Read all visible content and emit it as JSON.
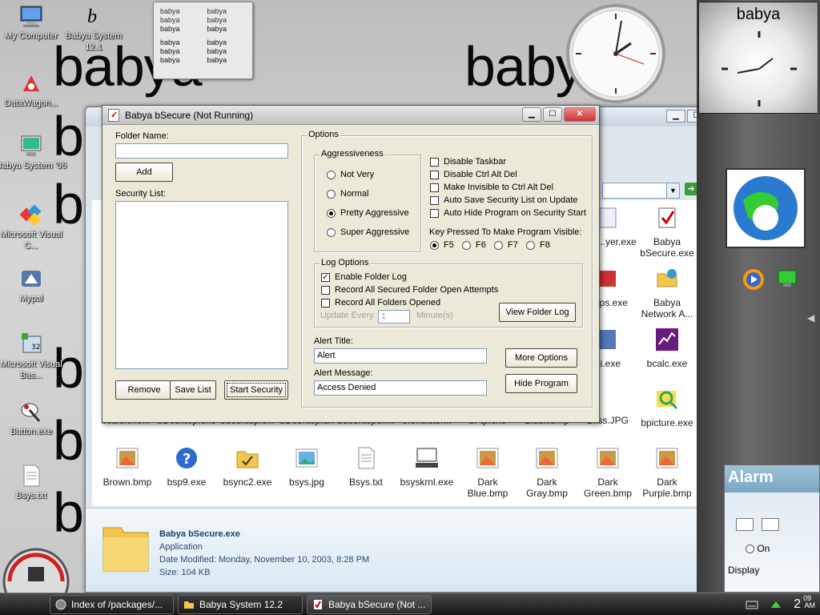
{
  "desktop": {
    "background_word": "babya",
    "icons": [
      {
        "label": "My Computer",
        "icon": "computer-icon"
      },
      {
        "label": "Babya System 12.1",
        "icon": "babya-logo-icon"
      },
      {
        "label": "DataWagon...",
        "icon": "datawagon-icon"
      },
      {
        "label": "Babya System '06",
        "icon": "babya-system-icon"
      },
      {
        "label": "Microsoft Visual C...",
        "icon": "visual-c-icon"
      },
      {
        "label": "Mypal",
        "icon": "mypal-icon"
      },
      {
        "label": "Microsoft Visual Bas...",
        "icon": "visual-basic-icon"
      },
      {
        "label": "Button.exe",
        "icon": "button-exe-icon"
      },
      {
        "label": "Bsys.txt",
        "icon": "text-file-icon"
      }
    ]
  },
  "note_gadget": {
    "rows": [
      [
        "babya",
        "babya"
      ],
      [
        "babya",
        "babya"
      ],
      [
        "babya",
        "babya"
      ],
      [
        "babya",
        "babya"
      ],
      [
        "babya",
        "babya"
      ],
      [
        "babya",
        "babya"
      ]
    ]
  },
  "sidebar": {
    "clock_title": "babya",
    "alarm_title": "Alarm",
    "alarm_on_label": "On",
    "alarm_display_label": "Display"
  },
  "explorer": {
    "go_label": "Go",
    "files": [
      {
        "label": "Babya bSecure.exe",
        "icon": "bsecure-icon"
      },
      {
        "label": "Babya Network A...",
        "icon": "network-icon"
      },
      {
        "label": "bcalc.exe",
        "icon": "bcalc-icon"
      },
      {
        "label": "bpicture.exe",
        "icon": "bpicture-icon"
      },
      {
        "label": "Brown.bmp",
        "icon": "bmp-icon"
      },
      {
        "label": "bsp9.exe",
        "icon": "help-icon"
      },
      {
        "label": "bsync2.exe",
        "icon": "folder-sync-icon"
      },
      {
        "label": "bsys.jpg",
        "icon": "jpg-icon"
      },
      {
        "label": "Bsys.txt",
        "icon": "text-file-icon"
      },
      {
        "label": "bsyskrnl.exe",
        "icon": "kernel-icon"
      },
      {
        "label": "Dark Blue.bmp",
        "icon": "bmp-icon"
      },
      {
        "label": "Dark Gray.bmp",
        "icon": "bmp-icon"
      },
      {
        "label": "Dark Green.bmp",
        "icon": "bmp-icon"
      },
      {
        "label": "Dark Purple.bmp",
        "icon": "bmp-icon"
      }
    ],
    "partial_labels": [
      "bcalc.exe...",
      "bDesktop.exe",
      "bdesktop.c...",
      "bDesktop.url",
      "bdesktopex...",
      "bfontlister...",
      "bFtp.exe",
      "Black.bmp",
      "Bliss.JPG",
      "aya ...yer.exe",
      "Apps.exe",
      "ai.exe"
    ],
    "details": {
      "name": "Babya bSecure.exe",
      "type": "Application",
      "modified": "Date Modified: Monday, November 10, 2003, 8:28 PM",
      "size": "Size: 104 KB"
    }
  },
  "dialog": {
    "title": "Babya bSecure (Not Running)",
    "folder_name_label": "Folder Name:",
    "folder_name_value": "",
    "add_button": "Add",
    "security_list_label": "Security List:",
    "remove_button": "Remove",
    "save_list_button": "Save List",
    "start_security_button": "Start Security",
    "options_legend": "Options",
    "aggressiveness_legend": "Aggressiveness",
    "aggressiveness_options": [
      {
        "label": "Not Very",
        "selected": false
      },
      {
        "label": "Normal",
        "selected": false
      },
      {
        "label": "Pretty Aggressive",
        "selected": true
      },
      {
        "label": "Super Aggressive",
        "selected": false
      }
    ],
    "checkboxes": [
      {
        "label": "Disable Taskbar",
        "checked": false
      },
      {
        "label": "Disable Ctrl Alt Del",
        "checked": false
      },
      {
        "label": "Make Invisible to Ctrl Alt Del",
        "checked": false
      },
      {
        "label": "Auto Save Security List on Update",
        "checked": false
      },
      {
        "label": "Auto Hide Program on Security Start",
        "checked": false
      }
    ],
    "key_label": "Key Pressed To Make Program Visible:",
    "keys": [
      {
        "label": "F5",
        "selected": true
      },
      {
        "label": "F6",
        "selected": false
      },
      {
        "label": "F7",
        "selected": false
      },
      {
        "label": "F8",
        "selected": false
      }
    ],
    "log_legend": "Log Options",
    "log_checkboxes": [
      {
        "label": "Enable Folder Log",
        "checked": true
      },
      {
        "label": "Record All Secured Folder Open Attempts",
        "checked": false
      },
      {
        "label": "Record All Folders Opened",
        "checked": false
      }
    ],
    "update_every_label": "Update Every",
    "update_every_value": "1",
    "minutes_label": "Minute(s)",
    "view_log_button": "View Folder Log",
    "alert_title_label": "Alert Title:",
    "alert_title_value": "Alert",
    "alert_message_label": "Alert Message:",
    "alert_message_value": "Access Denied",
    "more_options_button": "More Options",
    "hide_program_button": "Hide Program"
  },
  "taskbar": {
    "items": [
      {
        "label": "Index of /packages/...",
        "icon": "browser-icon",
        "active": false
      },
      {
        "label": "Babya System 12.2",
        "icon": "folder-icon",
        "active": false
      },
      {
        "label": "Babya bSecure (Not ...",
        "icon": "bsecure-icon",
        "active": true
      }
    ],
    "clock_hour": "2",
    "clock_minute": "09",
    "clock_ampm": "AM"
  }
}
